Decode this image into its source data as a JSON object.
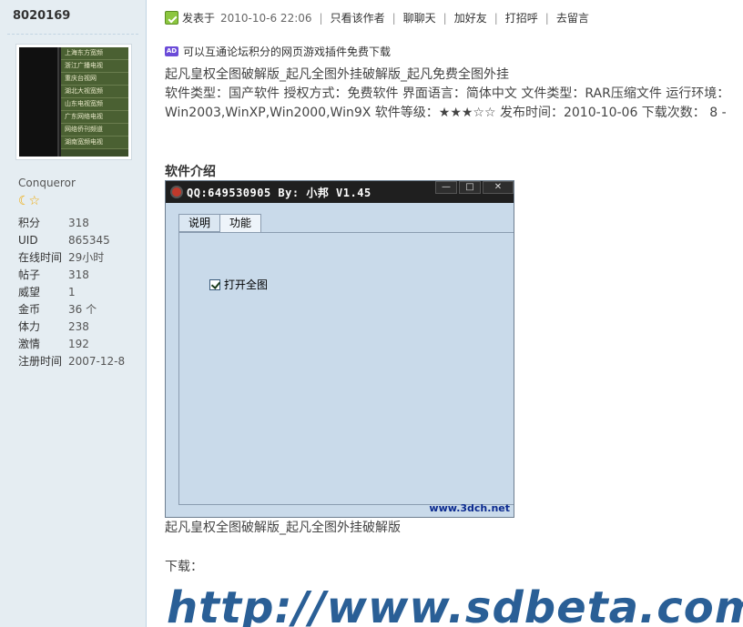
{
  "user": {
    "name": "8020169",
    "title": "Conqueror",
    "rank_icons": "☾☆",
    "avatar_menu": [
      "上海东方宽频",
      "浙江广播电视",
      "重庆台视网",
      "湖北大视宽频",
      "山东电视宽频",
      "广东网络电视",
      "网络侨刊频道",
      "湖南宽频电视"
    ],
    "stats": [
      {
        "label": "积分",
        "value": "318"
      },
      {
        "label": "UID",
        "value": "865345"
      },
      {
        "label": "在线时间",
        "value": "29小时"
      },
      {
        "label": "帖子",
        "value": "318"
      },
      {
        "label": "威望",
        "value": "1"
      },
      {
        "label": "金币",
        "value": "36 个"
      },
      {
        "label": "体力",
        "value": "238"
      },
      {
        "label": "激情",
        "value": "192"
      },
      {
        "label": "注册时间",
        "value": "2007-12-8"
      }
    ]
  },
  "postinfo": {
    "posted_label": "发表于",
    "time": "2010-10-6 22:06",
    "only_author": "只看该作者",
    "chat": "聊聊天",
    "add_friend": "加好友",
    "greet": "打招呼",
    "leave_message": "去留言"
  },
  "ad": {
    "icon_text": "AD",
    "text": "可以互通论坛积分的网页游戏插件免费下载"
  },
  "content": {
    "title_line": "起凡皇权全图破解版_起凡全图外挂破解版_起凡免费全图外挂",
    "info_line": "软件类型：国产软件  授权方式：免费软件  界面语言：简体中文  文件类型：RAR压缩文件  运行环境：Win2003,WinXP,Win2000,Win9X 软件等级：★★★☆☆ 发布时间：2010-10-06 下载次数：  8 -",
    "section_title": "软件介绍",
    "caption": "起凡皇权全图破解版_起凡全图外挂破解版",
    "download_label": "下载：",
    "download_link": "http://www.sdbeta.com/"
  },
  "app_window": {
    "title": "QQ:649530905 By: 小邦 V1.45",
    "min": "—",
    "max": "□",
    "close": "✕",
    "tabs": [
      "说明",
      "功能"
    ],
    "checkbox_label": "打开全图",
    "watermark": "www.3dch.net"
  }
}
